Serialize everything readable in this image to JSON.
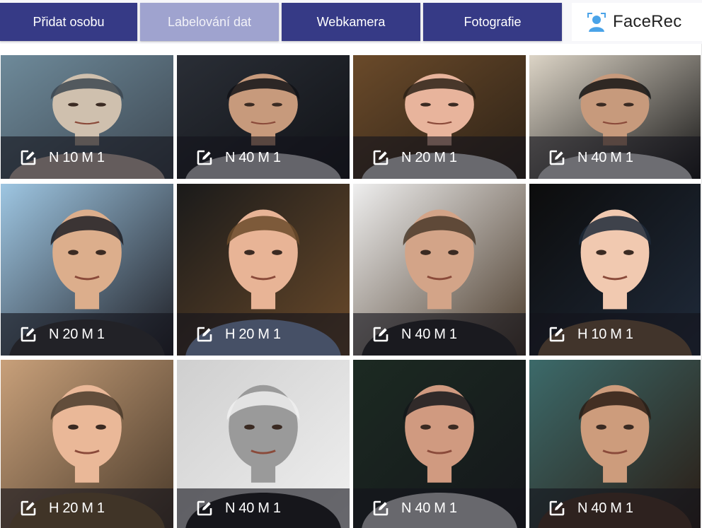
{
  "nav": {
    "tabs": [
      {
        "label": "Přidat osobu",
        "active": false
      },
      {
        "label": "Labelování dat",
        "active": true
      },
      {
        "label": "Webkamera",
        "active": false
      },
      {
        "label": "Fotografie",
        "active": false
      }
    ],
    "brand": {
      "name": "FaceRec",
      "icon": "person-silhouette-icon"
    }
  },
  "colors": {
    "tab_bg": "#363a86",
    "tab_active_bg": "#9fa3cf",
    "overlay_bg": "rgba(20,20,28,0.62)",
    "brand_icon": "#4aa3e8"
  },
  "cards": [
    {
      "label": "N 10 M 1",
      "icon": "edit-icon",
      "palette": [
        "#6e8a9a",
        "#cfc0ae",
        "#e6d3c6",
        "#3c4650"
      ]
    },
    {
      "label": "N 40 M 1",
      "icon": "edit-icon",
      "palette": [
        "#2a2e36",
        "#c79a7c",
        "#e8e8ea",
        "#101216"
      ]
    },
    {
      "label": "N 20 M 1",
      "icon": "edit-icon",
      "palette": [
        "#6a4a2a",
        "#e8b49c",
        "#f4f4f4",
        "#2c2116"
      ]
    },
    {
      "label": "N 40 M 1",
      "icon": "edit-icon",
      "palette": [
        "#dcd4c6",
        "#c79a7c",
        "#ffffff",
        "#141414"
      ]
    },
    {
      "label": "N 20 M 1",
      "icon": "edit-icon",
      "palette": [
        "#9ec6e2",
        "#dcae8c",
        "#3a3a3a",
        "#1e1e24"
      ]
    },
    {
      "label": "H 20 M 1",
      "icon": "edit-icon",
      "palette": [
        "#1a1a1a",
        "#e8b496",
        "#9ab4e0",
        "#6a4a2a"
      ]
    },
    {
      "label": "N 40 M 1",
      "icon": "edit-icon",
      "palette": [
        "#eeeeee",
        "#d3a488",
        "#262626",
        "#4a3a2a"
      ]
    },
    {
      "label": "H 10 M 1",
      "icon": "edit-icon",
      "palette": [
        "#0c0c0c",
        "#f1c9b0",
        "#8c6a44",
        "#1f2a3a"
      ]
    },
    {
      "label": "H 20 M 1",
      "icon": "edit-icon",
      "palette": [
        "#c8a07a",
        "#eab898",
        "#8a6a3c",
        "#4a3a2a"
      ]
    },
    {
      "label": "N 40 M 1",
      "icon": "edit-icon",
      "palette": [
        "#cfcfcf",
        "#9a9a9a",
        "#1c1c1c",
        "#f0f0f0"
      ]
    },
    {
      "label": "N 40 M 1",
      "icon": "edit-icon",
      "palette": [
        "#1c2a22",
        "#d09a80",
        "#f2f2f2",
        "#14161a"
      ]
    },
    {
      "label": "N 40 M 1",
      "icon": "edit-icon",
      "palette": [
        "#3c6a6a",
        "#cd9c7c",
        "#5a3a26",
        "#2a1c14"
      ]
    }
  ]
}
